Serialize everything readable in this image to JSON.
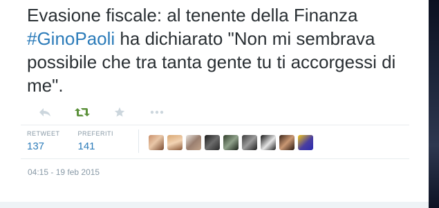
{
  "tweet": {
    "text_before": "Evasione fiscale: al tenente della Finanza ",
    "hashtag": "#GinoPaoli",
    "text_after": " ha dichiarato \"Non mi sembrava possibile che tra tanta gente tu ti accorgessi di me\".",
    "hashtag_color": "#2b7bb9",
    "text_color": "#292f33"
  },
  "actions": [
    {
      "name": "reply",
      "icon": "reply-icon"
    },
    {
      "name": "retweet",
      "icon": "retweet-icon",
      "color": "#5c913b"
    },
    {
      "name": "favorite",
      "icon": "star-icon"
    },
    {
      "name": "more",
      "icon": "more-dots-icon"
    }
  ],
  "stats": {
    "retweet_label": "RETWEET",
    "retweet_count": "137",
    "favorites_label": "PREFERITI",
    "favorites_count": "141"
  },
  "avatars": [
    {
      "icon": "user-avatar"
    },
    {
      "icon": "user-avatar"
    },
    {
      "icon": "user-avatar"
    },
    {
      "icon": "user-avatar"
    },
    {
      "icon": "user-avatar"
    },
    {
      "icon": "user-avatar"
    },
    {
      "icon": "user-avatar"
    },
    {
      "icon": "user-avatar"
    },
    {
      "icon": "user-avatar"
    }
  ],
  "timestamp": "04:15 - 19 feb 2015"
}
